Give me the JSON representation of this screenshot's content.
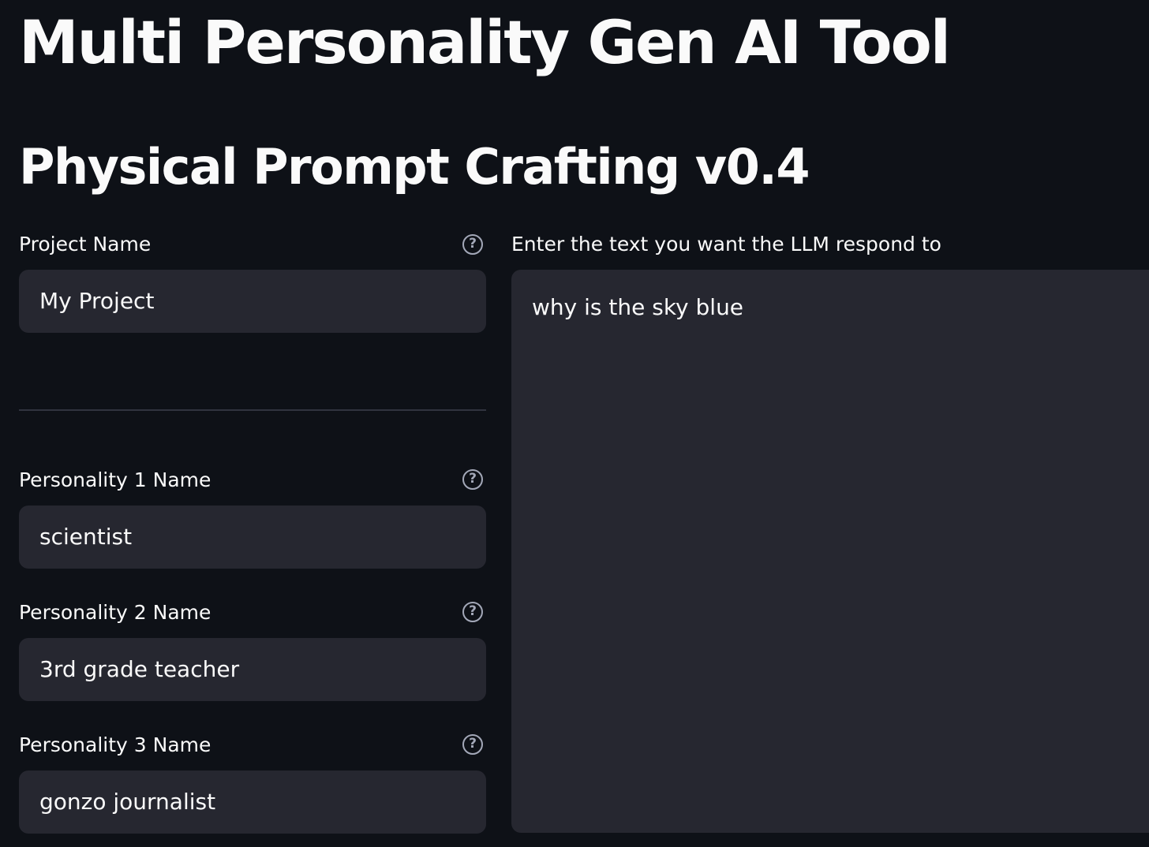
{
  "header": {
    "title": "Multi Personality Gen AI Tool",
    "subtitle": "Physical Prompt Crafting v0.4"
  },
  "form": {
    "project_name": {
      "label": "Project Name",
      "value": "My Project"
    },
    "personalities": [
      {
        "label": "Personality 1 Name",
        "value": "scientist"
      },
      {
        "label": "Personality 2 Name",
        "value": "3rd grade teacher"
      },
      {
        "label": "Personality 3 Name",
        "value": "gonzo journalist"
      }
    ],
    "prompt": {
      "label": "Enter the text you want the LLM respond to",
      "value": "why is the sky blue"
    },
    "help_glyph": "?"
  },
  "icons": {
    "help": "question-circle-icon"
  },
  "colors": {
    "background": "#0e1117",
    "input_background": "#262730",
    "text": "#fafafa",
    "help_icon": "#a3a8b8",
    "divider": "#31333f"
  }
}
